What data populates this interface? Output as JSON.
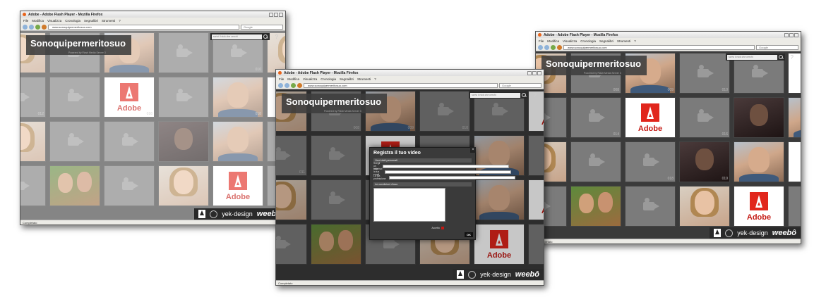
{
  "browser": {
    "window_title": "Adobe - Adobe Flash Player - Mozilla Firefox",
    "menu": [
      "File",
      "Modifica",
      "Visualizza",
      "Cronologia",
      "Segnalibri",
      "Strumenti",
      "?"
    ],
    "url": "www.sonoquipermeritosuo.com",
    "search_placeholder": "Google",
    "status": "Completato"
  },
  "app": {
    "title": "Sonoquipermeritosuo",
    "subtitle": "Powered by Flash Media Server 3",
    "search_placeholder": "scrivi il nick che cerchi",
    "help": "?",
    "adobe_label": "Adobe",
    "footer": {
      "yek": "yek·design",
      "weebo": "weebô"
    }
  },
  "tile_numbers": {
    "w1": [
      "",
      "",
      "",
      "",
      "010",
      "011",
      "012",
      "",
      "016",
      "",
      "018",
      "",
      "",
      "",
      "",
      "",
      "",
      "021",
      "",
      "",
      "",
      "",
      "",
      ""
    ],
    "w2": [
      "",
      "008",
      "009",
      "010",
      "",
      "",
      "011",
      "",
      "",
      "",
      "",
      "016",
      "",
      "",
      "",
      "",
      "",
      "021",
      "",
      "",
      "",
      "",
      "",
      ""
    ],
    "w3": [
      "",
      "008",
      "009",
      "010",
      "",
      "011",
      "",
      "014",
      "",
      "016",
      "",
      "017",
      "",
      "",
      "018",
      "019",
      "",
      "",
      "",
      "",
      "",
      "",
      "",
      ""
    ]
  },
  "modal": {
    "title": "Registra il tuo video",
    "section_personal": "I tuoi dati personali",
    "field_nick": "Scegli un nick",
    "field_email": "Inserisci la tua email",
    "field_profession": "La tua professione",
    "section_terms": "Le condizioni d'uso",
    "accept": "Accetto",
    "ok": "OK",
    "close": "×"
  }
}
